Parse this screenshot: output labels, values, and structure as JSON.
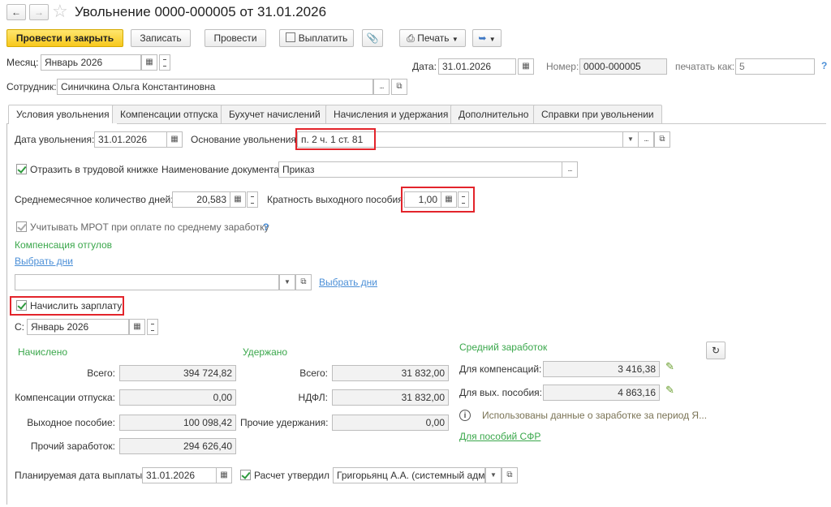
{
  "window": {
    "title": "Увольнение 0000-000005 от 31.01.2026"
  },
  "toolbar": {
    "post_close": "Провести и закрыть",
    "write": "Записать",
    "post": "Провести",
    "pay": "Выплатить",
    "print": "Печать"
  },
  "header": {
    "month_label": "Месяц:",
    "month_value": "Январь 2026",
    "date_label": "Дата:",
    "date_value": "31.01.2026",
    "number_label": "Номер:",
    "number_value": "0000-000005",
    "print_as_label": "печатать как:",
    "print_as_placeholder": "5",
    "help": "?",
    "employee_label": "Сотрудник:",
    "employee_value": "Синичкина Ольга Константиновна"
  },
  "tabs": [
    "Условия увольнения",
    "Компенсации отпуска",
    "Бухучет начислений",
    "Начисления и удержания",
    "Дополнительно",
    "Справки при увольнении"
  ],
  "form": {
    "dismissal_date_label": "Дата увольнения:",
    "dismissal_date": "31.01.2026",
    "reason_label": "Основание увольнения:",
    "reason_value": "п. 2 ч. 1 ст. 81",
    "workbook_checkbox": "Отразить в трудовой книжке",
    "workbook_checked": true,
    "doc_name_label": "Наименование документа:",
    "doc_name_value": "Приказ",
    "avg_days_label": "Среднемесячное количество дней:",
    "avg_days_value": "20,583",
    "severance_mult_label": "Кратность выходного пособия:",
    "severance_mult_value": "1,00",
    "mrot_checkbox": "Учитывать МРОТ при оплате по среднему заработку",
    "mrot_checked": true,
    "mrot_help": "?",
    "comp_leaves_title": "Компенсация отгулов",
    "select_days_link_1": "Выбрать дни",
    "select_days_link_2": "Выбрать дни",
    "accrue_salary_checkbox": "Начислить зарплату",
    "accrue_salary_checked": true,
    "from_label": "С:",
    "from_value": "Январь 2026"
  },
  "accrued": {
    "title": "Начислено",
    "total_label": "Всего:",
    "total_value": "394 724,82",
    "vacation_comp_label": "Компенсации отпуска:",
    "vacation_comp_value": "0,00",
    "severance_label": "Выходное пособие:",
    "severance_value": "100 098,42",
    "other_earnings_label": "Прочий заработок:",
    "other_earnings_value": "294 626,40"
  },
  "withheld": {
    "title": "Удержано",
    "total_label": "Всего:",
    "total_value": "31 832,00",
    "ndfl_label": "НДФЛ:",
    "ndfl_value": "31 832,00",
    "other_label": "Прочие удержания:",
    "other_value": "0,00"
  },
  "avg_earnings": {
    "title": "Средний заработок",
    "for_comp_label": "Для компенсаций:",
    "for_comp_value": "3 416,38",
    "for_severance_label": "Для вых. пособия:",
    "for_severance_value": "4 863,16",
    "info_text": "Использованы данные о заработке за период Я...",
    "sfr_link": "Для пособий СФР"
  },
  "footer": {
    "pay_date_label": "Планируемая дата выплаты:",
    "pay_date_value": "31.01.2026",
    "approved_checkbox": "Расчет утвердил",
    "approved_checked": true,
    "approver_value": "Григорьянц А.А. (системный адми"
  },
  "colors": {
    "accent_green": "#3aa74b",
    "link_blue": "#4b8fd7",
    "highlight_red": "#e3242b",
    "primary_yellow": "#f7c81d"
  }
}
